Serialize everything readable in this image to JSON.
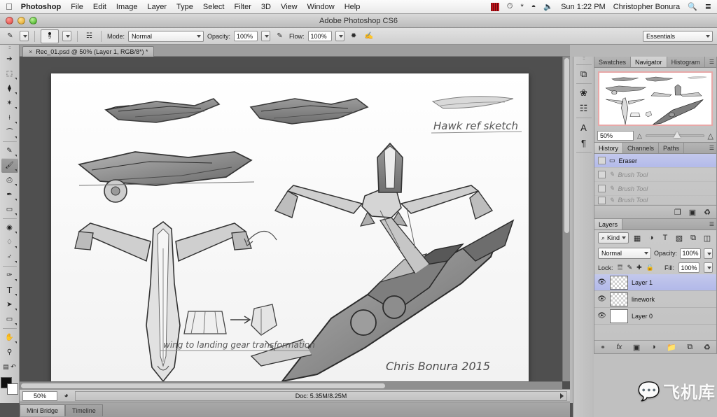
{
  "macbar": {
    "apple_icon": "apple-icon",
    "items": [
      {
        "label": "Photoshop",
        "bold": true
      },
      {
        "label": "File"
      },
      {
        "label": "Edit"
      },
      {
        "label": "Image"
      },
      {
        "label": "Layer"
      },
      {
        "label": "Type"
      },
      {
        "label": "Select"
      },
      {
        "label": "Filter"
      },
      {
        "label": "3D"
      },
      {
        "label": "View"
      },
      {
        "label": "Window"
      },
      {
        "label": "Help"
      }
    ],
    "status": {
      "time_machine_icon": "clock-icon",
      "bluetooth_icon": "bluetooth-icon",
      "wifi_icon": "wifi-icon",
      "volume_icon": "volume-icon",
      "clock": "Sun 1:22 PM",
      "user": "Christopher Bonura",
      "search_icon": "search-icon",
      "notification_icon": "notification-list-icon"
    }
  },
  "window": {
    "title": "Adobe Photoshop CS6"
  },
  "options": {
    "brush_size": "9",
    "mode_label": "Mode:",
    "mode_value": "Normal",
    "opacity_label": "Opacity:",
    "opacity_value": "100%",
    "flow_label": "Flow:",
    "flow_value": "100%",
    "workspace": "Essentials"
  },
  "document_tab": {
    "close": "×",
    "title": "Rec_01.psd @ 50% (Layer 1, RGB/8*) *"
  },
  "toolbar": {
    "top": [
      {
        "name": "move-tool",
        "glyph": "↖"
      },
      {
        "name": "marquee-tool",
        "glyph": "⬚"
      },
      {
        "name": "lasso-tool",
        "glyph": "⧫"
      },
      {
        "name": "quick-selection-tool",
        "glyph": "✦"
      },
      {
        "name": "crop-tool",
        "glyph": "⌗"
      },
      {
        "name": "eyedropper-tool",
        "glyph": "✐"
      },
      {
        "name": "healing-brush-tool",
        "glyph": "✒"
      },
      {
        "name": "brush-tool",
        "glyph": "✎",
        "selected": true
      },
      {
        "name": "clone-stamp-tool",
        "glyph": "⎙"
      },
      {
        "name": "history-brush-tool",
        "glyph": "✐"
      },
      {
        "name": "eraser-tool",
        "glyph": "▱"
      },
      {
        "name": "gradient-tool",
        "glyph": "▤"
      },
      {
        "name": "blur-tool",
        "glyph": "○"
      },
      {
        "name": "dodge-tool",
        "glyph": "⚲"
      }
    ],
    "bottom": [
      {
        "name": "pen-tool",
        "glyph": "✑"
      },
      {
        "name": "type-tool",
        "glyph": "T"
      },
      {
        "name": "path-selection-tool",
        "glyph": "➤"
      },
      {
        "name": "rectangle-shape-tool",
        "glyph": "▭"
      },
      {
        "name": "hand-tool",
        "glyph": "✋"
      },
      {
        "name": "zoom-tool",
        "glyph": "⚲"
      }
    ],
    "swatch_fg": "#111111",
    "swatch_bg": "#ffffff"
  },
  "canvas": {
    "annotation_hawk": "Hawk ref sketch",
    "annotation_wing": "wing to landing gear transformation",
    "signature": "Chris Bonura 2015"
  },
  "status_bar": {
    "zoom": "50%",
    "doc_info": "Doc: 5.35M/8.25M"
  },
  "bottom_tabs": [
    {
      "label": "Mini Bridge",
      "active": true
    },
    {
      "label": "Timeline",
      "active": false
    }
  ],
  "dock_strip": [
    {
      "name": "mini-bridge-icon",
      "glyph": "⧉"
    },
    {
      "name": "brush-panel-icon",
      "glyph": "❀"
    },
    {
      "name": "adjustments-panel-icon",
      "glyph": "☲"
    },
    {
      "name": "character-panel-icon",
      "glyph": "A"
    },
    {
      "name": "paragraph-panel-icon",
      "glyph": "¶"
    }
  ],
  "navigator_panel": {
    "tabs": [
      {
        "label": "Swatches",
        "active": false
      },
      {
        "label": "Navigator",
        "active": true
      },
      {
        "label": "Histogram",
        "active": false
      }
    ],
    "zoom_value": "50%",
    "zoom_out_icon": "zoom-out-icon",
    "zoom_in_icon": "zoom-in-icon",
    "menu_icon": "panel-menu-icon"
  },
  "history_panel": {
    "tabs": [
      {
        "label": "History",
        "active": true
      },
      {
        "label": "Channels",
        "active": false
      },
      {
        "label": "Paths",
        "active": false
      }
    ],
    "menu_icon": "panel-menu-icon",
    "items": [
      {
        "label": "Eraser",
        "icon": "eraser-icon",
        "selected": true
      },
      {
        "label": "Brush Tool",
        "icon": "brush-icon",
        "selected": false
      },
      {
        "label": "Brush Tool",
        "icon": "brush-icon",
        "selected": false
      },
      {
        "label": "Brush Tool",
        "icon": "brush-icon",
        "selected": false
      }
    ],
    "footer": [
      {
        "name": "new-document-from-state-icon",
        "glyph": "❐"
      },
      {
        "name": "new-snapshot-icon",
        "glyph": "▣"
      },
      {
        "name": "delete-state-icon",
        "glyph": "⌧"
      }
    ]
  },
  "layers_panel": {
    "tab": "Layers",
    "menu_icon": "panel-menu-icon",
    "filter_kind": "Kind",
    "filter_icons": [
      {
        "name": "filter-pixel-icon",
        "glyph": "▦"
      },
      {
        "name": "filter-adjustment-icon",
        "glyph": "◑"
      },
      {
        "name": "filter-type-icon",
        "glyph": "T"
      },
      {
        "name": "filter-shape-icon",
        "glyph": "▧"
      },
      {
        "name": "filter-smart-object-icon",
        "glyph": "⧉"
      }
    ],
    "blend_mode": "Normal",
    "opacity_label": "Opacity:",
    "opacity_value": "100%",
    "lock_label": "Lock:",
    "lock_icons": [
      {
        "name": "lock-transparent-pixels-icon",
        "glyph": "⬚"
      },
      {
        "name": "lock-image-pixels-icon",
        "glyph": "✎"
      },
      {
        "name": "lock-position-icon",
        "glyph": "✚"
      },
      {
        "name": "lock-all-icon",
        "glyph": "ὑ2"
      }
    ],
    "fill_label": "Fill:",
    "fill_value": "100%",
    "layers": [
      {
        "name": "Layer 1",
        "visible": true,
        "selected": true,
        "thumb": "transparent"
      },
      {
        "name": "linework",
        "visible": true,
        "selected": false,
        "thumb": "transparent"
      },
      {
        "name": "Layer 0",
        "visible": true,
        "selected": false,
        "thumb": "solid"
      }
    ],
    "footer": [
      {
        "name": "link-layers-icon",
        "glyph": "⚭"
      },
      {
        "name": "layer-style-icon",
        "glyph": "fx"
      },
      {
        "name": "layer-mask-icon",
        "glyph": "▣"
      },
      {
        "name": "adjustment-layer-icon",
        "glyph": "◑"
      },
      {
        "name": "new-group-icon",
        "glyph": "☐"
      },
      {
        "name": "new-layer-icon",
        "glyph": "⧉"
      },
      {
        "name": "delete-layer-icon",
        "glyph": "⌧"
      }
    ]
  },
  "watermark": {
    "icon": "wechat-icon",
    "text": "飞机库"
  }
}
